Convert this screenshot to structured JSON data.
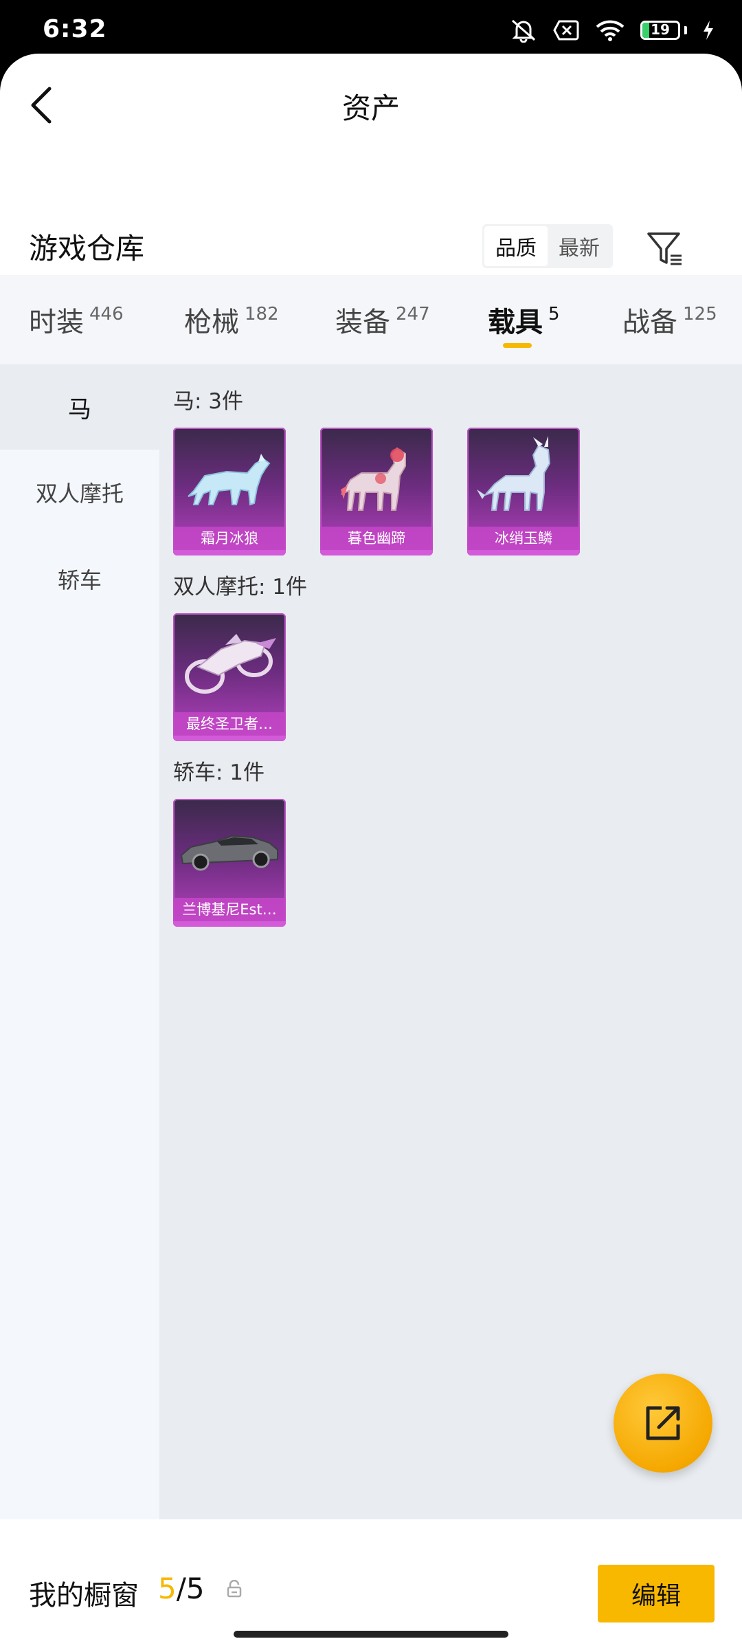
{
  "status_bar": {
    "time": "6:32",
    "battery_level": "19",
    "battery_fraction": 0.19,
    "icons": [
      "mute-vibrate-icon",
      "no-sim-icon",
      "wifi-icon",
      "battery-icon",
      "charging-icon"
    ]
  },
  "header": {
    "title": "资产",
    "back_icon": "chevron-left-icon"
  },
  "warehouse": {
    "title": "游戏仓库",
    "sort_options": [
      "品质",
      "最新"
    ],
    "active_sort": "品质",
    "filter_icon": "filter-icon"
  },
  "tabs": [
    {
      "label": "时装",
      "count": "446"
    },
    {
      "label": "枪械",
      "count": "182"
    },
    {
      "label": "装备",
      "count": "247"
    },
    {
      "label": "载具",
      "count": "5"
    },
    {
      "label": "战备",
      "count": "125"
    }
  ],
  "active_tab": "载具",
  "sidebar": {
    "items": [
      {
        "label": "马"
      },
      {
        "label": "双人摩托"
      },
      {
        "label": "轿车"
      }
    ],
    "active": "马"
  },
  "groups": [
    {
      "label": "马: 3件",
      "items": [
        {
          "name": "霜月冰狼",
          "icon": "ice-wolf-image"
        },
        {
          "name": "暮色幽蹄",
          "icon": "horse-image"
        },
        {
          "name": "冰绡玉鳞",
          "icon": "qilin-image"
        }
      ]
    },
    {
      "label": "双人摩托: 1件",
      "items": [
        {
          "name": "最终圣卫者…",
          "icon": "motorcycle-image"
        }
      ]
    },
    {
      "label": "轿车: 1件",
      "items": [
        {
          "name": "兰博基尼Est…",
          "icon": "sports-car-image"
        }
      ]
    }
  ],
  "fab": {
    "icon": "share-external-icon"
  },
  "bottom_bar": {
    "label": "我的橱窗",
    "current": "5",
    "separator": "/",
    "total": "5",
    "lock_icon": "lock-icon",
    "edit_label": "编辑"
  },
  "colors": {
    "accent": "#f6b800",
    "card_purple": "#9b3aa8",
    "card_name_bar": "#c446c8",
    "content_bg": "#e9ecf0",
    "sidebar_bg": "#f4f7fb"
  }
}
